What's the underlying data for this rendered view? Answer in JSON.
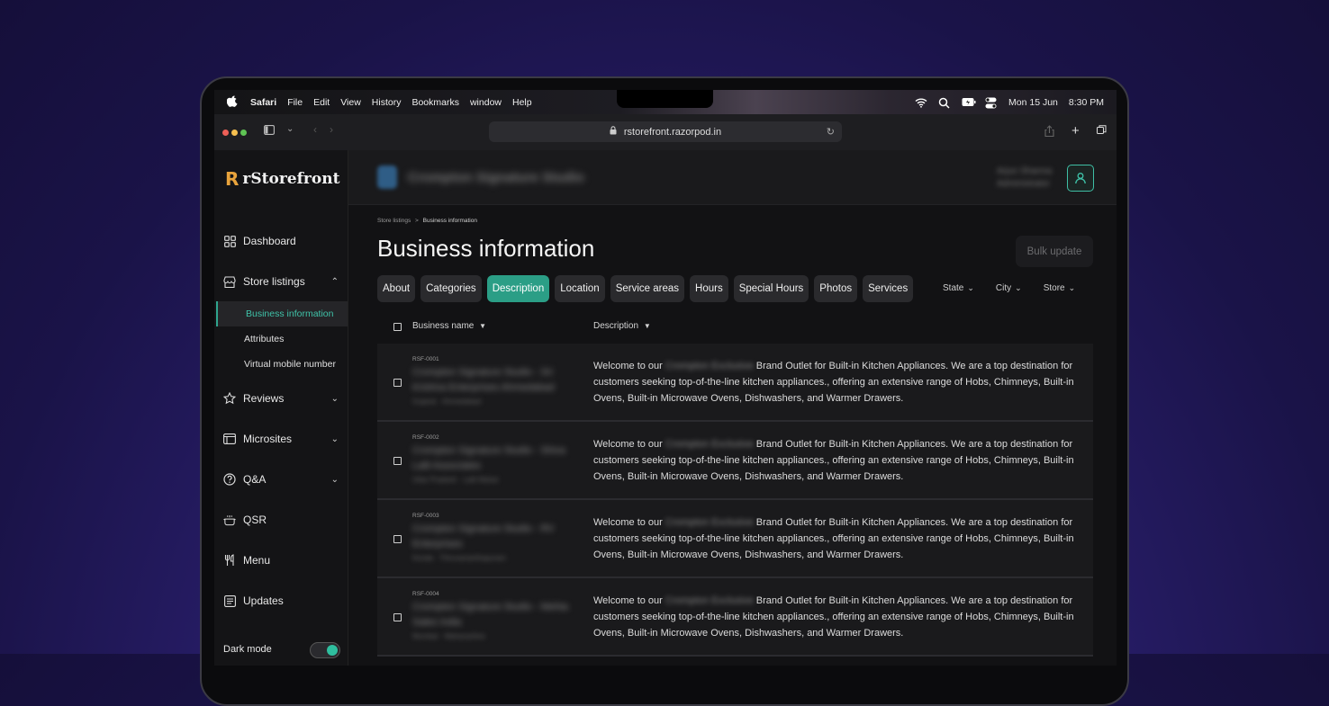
{
  "menubar": {
    "app": "Safari",
    "items": [
      "File",
      "Edit",
      "View",
      "History",
      "Bookmarks",
      "window",
      "Help"
    ],
    "date": "Mon 15 Jun",
    "time": "8:30 PM"
  },
  "browser": {
    "url": "rstorefront.razorpod.in"
  },
  "brand": {
    "logo_mark": "R",
    "name": "rStorefront",
    "accent": "#2b9e86"
  },
  "sidebar": {
    "dashboard": "Dashboard",
    "store_listings": "Store listings",
    "sub": [
      "Business information",
      "Attributes",
      "Virtual mobile number"
    ],
    "reviews": "Reviews",
    "microsites": "Microsites",
    "qa": "Q&A",
    "qsr": "QSR",
    "menu": "Menu",
    "updates": "Updates",
    "dark_mode": "Dark mode"
  },
  "header": {
    "store_name": "Crompton Signature Studio",
    "user_name": "Arjun Sharma",
    "user_role": "Administrator"
  },
  "page": {
    "breadcrumb_root": "Store listings",
    "breadcrumb_sep": ">",
    "breadcrumb_current": "Business information",
    "title": "Business information",
    "bulk_update": "Bulk update"
  },
  "tabs": [
    "About",
    "Categories",
    "Description",
    "Location",
    "Service areas",
    "Hours",
    "Special Hours",
    "Photos",
    "Services"
  ],
  "filters": [
    "State",
    "City",
    "Store"
  ],
  "table": {
    "col_business": "Business name",
    "col_description": "Description",
    "rows": [
      {
        "id": "RSF-0001",
        "name": "Crompton Signature Studio - Sri Krishna Enterprises Ahmedabad",
        "sub": "Gujarat · Ahmedabad",
        "desc_a": "Welcome to our",
        "desc_blur": "Crompton Exclusive",
        "desc_b": "Brand Outlet for Built-in Kitchen Appliances. We are a top destination for customers seeking top-of-the-line kitchen appliances., offering an extensive range of Hobs, Chimneys, Built-in Ovens, Built-in Microwave Ovens, Dishwashers, and Warmer Drawers."
      },
      {
        "id": "RSF-0002",
        "name": "Crompton Signature Studio - Shiva Lalit Associates",
        "sub": "Uttar Pradesh · Lalit Mahal",
        "desc_a": "Welcome to our",
        "desc_blur": "Crompton Exclusive",
        "desc_b": "Brand Outlet for Built-in Kitchen Appliances. We are a top destination for customers seeking top-of-the-line kitchen appliances., offering an extensive range of Hobs, Chimneys, Built-in Ovens, Built-in Microwave Ovens, Dishwashers, and Warmer Drawers."
      },
      {
        "id": "RSF-0003",
        "name": "Crompton Signature Studio - RV Enterprises",
        "sub": "Kerala · Thiruvananthapuram",
        "desc_a": "Welcome to our",
        "desc_blur": "Crompton Exclusive",
        "desc_b": "Brand Outlet for Built-in Kitchen Appliances. We are a top destination for customers seeking top-of-the-line kitchen appliances., offering an extensive range of Hobs, Chimneys, Built-in Ovens, Built-in Microwave Ovens, Dishwashers, and Warmer Drawers."
      },
      {
        "id": "RSF-0004",
        "name": "Crompton Signature Studio - Mehta Sales India",
        "sub": "Mumbai · Maharashtra",
        "desc_a": "Welcome to our",
        "desc_blur": "Crompton Exclusive",
        "desc_b": "Brand Outlet for Built-in Kitchen Appliances. We are a top destination for customers seeking top-of-the-line kitchen appliances., offering an extensive range of Hobs, Chimneys, Built-in Ovens, Built-in Microwave Ovens, Dishwashers, and Warmer Drawers."
      }
    ]
  }
}
